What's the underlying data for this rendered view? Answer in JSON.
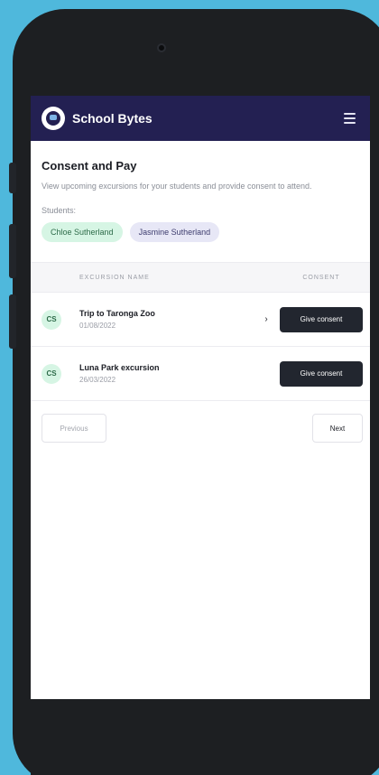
{
  "app": {
    "brand_name": "School Bytes",
    "menu_icon": "hamburger-menu-icon"
  },
  "page": {
    "title": "Consent and Pay",
    "description": "View upcoming excursions for your students and provide consent to attend.",
    "students_label": "Students:"
  },
  "students": [
    {
      "name": "Chloe Sutherland",
      "color": "#d6f5e4"
    },
    {
      "name": "Jasmine Sutherland",
      "color": "#e7e7f6"
    }
  ],
  "table": {
    "headers": {
      "name": "Excursion name",
      "consent": "Consent"
    },
    "rows": [
      {
        "initials": "CS",
        "title": "Trip to Taronga Zoo",
        "date": "01/08/2022",
        "arrow": "›",
        "action": "Give consent"
      },
      {
        "initials": "CS",
        "title": "Luna Park excursion",
        "date": "26/03/2022",
        "arrow": "",
        "action": "Give consent"
      }
    ]
  },
  "pagination": {
    "previous": "Previous",
    "next": "Next"
  },
  "colors": {
    "appbar": "#232052",
    "background": "#4fb8dc",
    "button": "#22262f"
  }
}
